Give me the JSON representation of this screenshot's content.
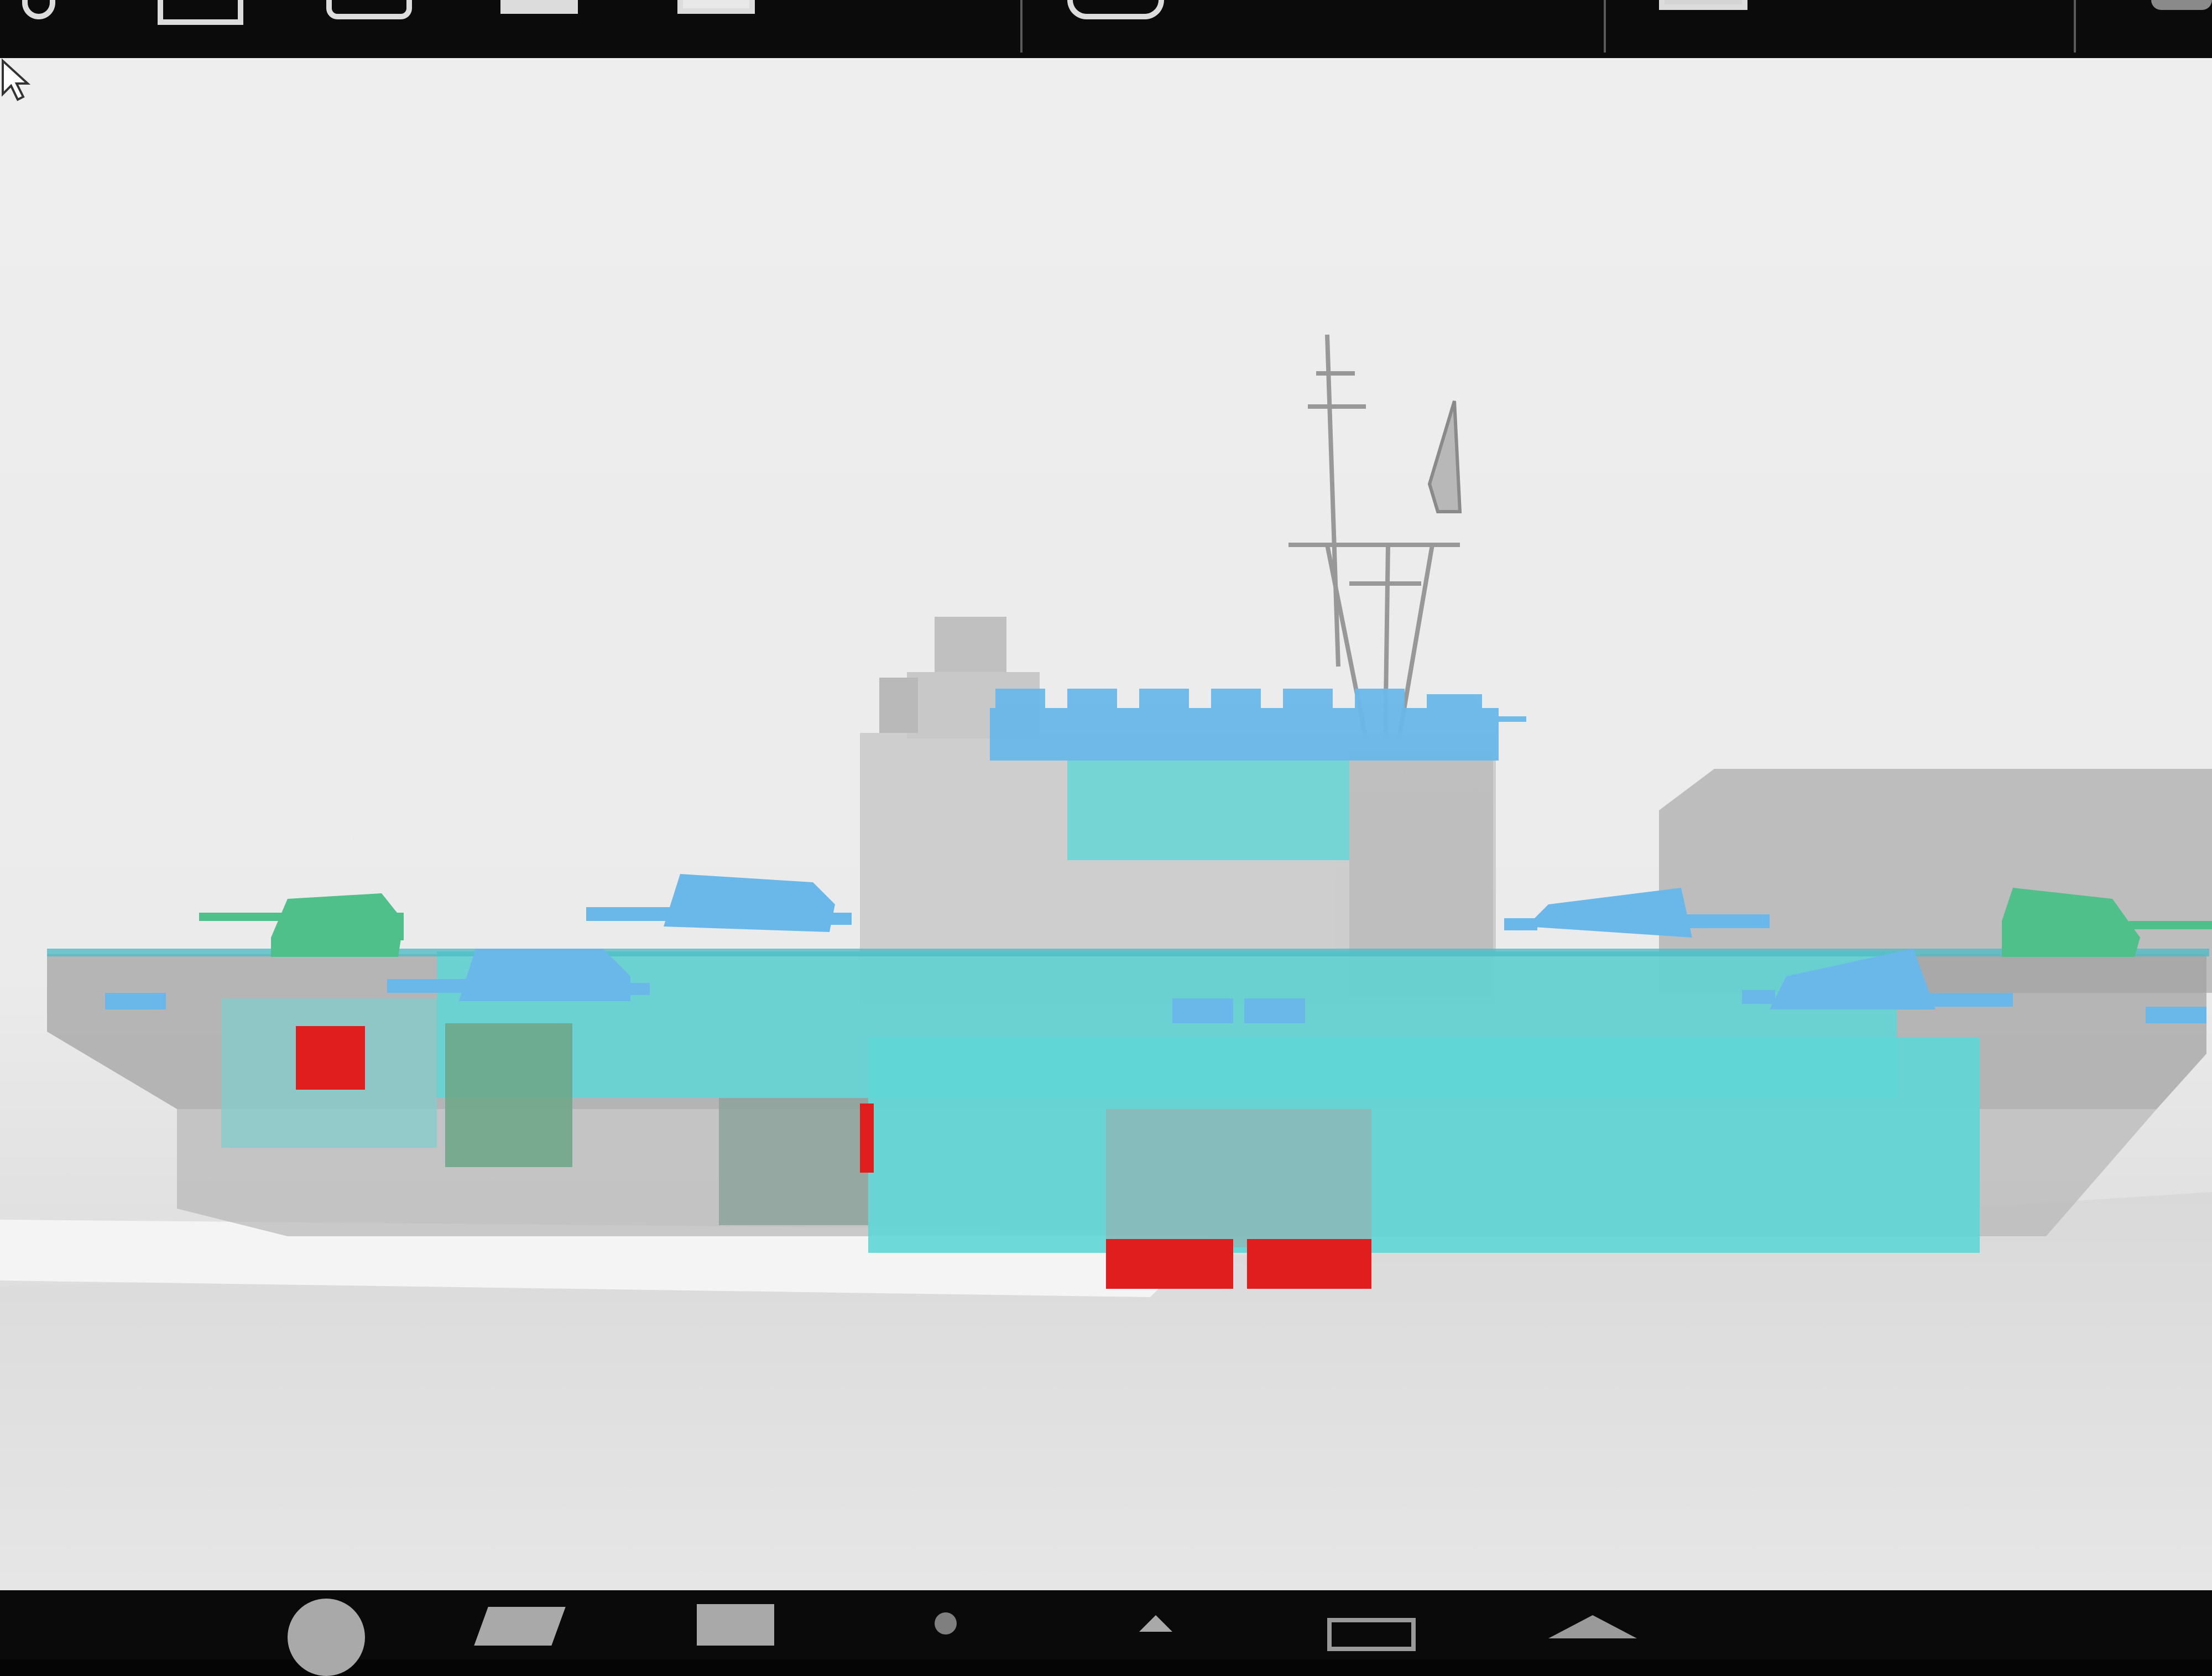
{
  "app": {
    "top_toolbar": {
      "buttons": [
        {
          "icon": "rotate-icon"
        },
        {
          "icon": "split-view-icon"
        },
        {
          "icon": "camera-icon"
        },
        {
          "icon": "frame-icon"
        },
        {
          "icon": "box-icon"
        },
        {
          "icon": "layers-icon"
        }
      ],
      "readout": ""
    },
    "bottom_toolbar": {
      "buttons": [
        {
          "icon": "info-icon"
        },
        {
          "icon": "layers-stack-icon"
        },
        {
          "icon": "screen-icon"
        },
        {
          "icon": "pin-icon"
        },
        {
          "icon": "up-arrow-icon"
        },
        {
          "icon": "rectangle-icon"
        },
        {
          "icon": "roof-icon"
        }
      ]
    },
    "viewport": {
      "model": "warship-side-view",
      "colors": {
        "hull_grey": "#9c9c9c",
        "transparent_cyan": "#5fd6d6",
        "turret_blue": "#6ab8ea",
        "green_parts": "#4fc08a",
        "red_blocks": "#e01e1e"
      }
    }
  }
}
